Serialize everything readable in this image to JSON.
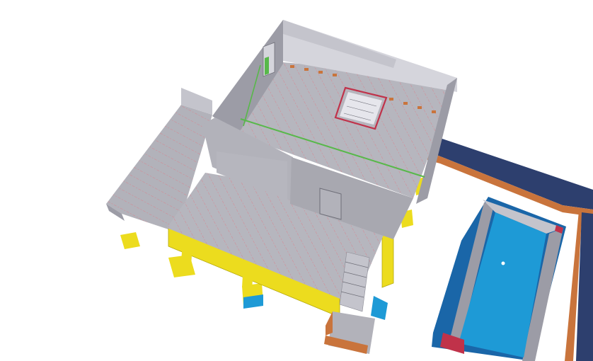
{
  "viewport": {
    "background": "#ffffff",
    "view_type": "3d-isometric-bim-model"
  },
  "model": {
    "components": [
      "building-walls",
      "floor-slabs",
      "floor-joists",
      "stair-opening",
      "exterior-stair",
      "support-beams",
      "footings",
      "swimming-pool",
      "pool-coping",
      "terrace-border"
    ]
  },
  "colors": {
    "wall": "#9c9ca6",
    "wall_light": "#d5d5dc",
    "floor": "#b2b2ba",
    "joist_line": "#e07a86",
    "beam_yellow": "#ecdc1e",
    "beam_yellow_dark": "#b5a80c",
    "pool_water": "#1e9ad6",
    "pool_rim": "#1a66a8",
    "terrace_blue": "#2d3f6e",
    "terrace_orange": "#c9743c",
    "opening_red": "#c0324a",
    "green_accent": "#58b84a"
  }
}
